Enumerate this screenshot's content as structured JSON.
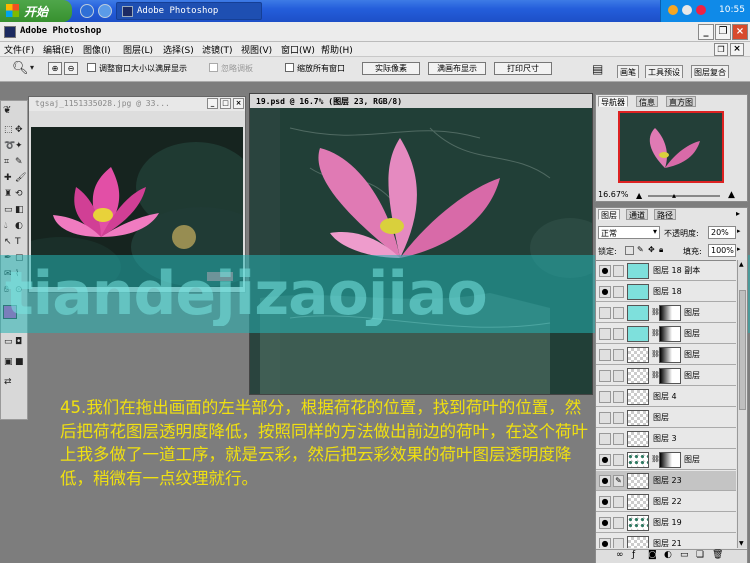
{
  "taskbar": {
    "start_label": "开始",
    "task_label": "Adobe Photoshop",
    "clock": "10:55"
  },
  "app": {
    "title": "Adobe Photoshop"
  },
  "menus": [
    "文件(F)",
    "编辑(E)",
    "图像(I)",
    "图层(L)",
    "选择(S)",
    "滤镜(T)",
    "视图(V)",
    "窗口(W)",
    "帮助(H)"
  ],
  "options": {
    "resize_window": "调整窗口大小以满屏显示",
    "ignore_palettes": "忽略调板",
    "zoom_all": "缩放所有窗口",
    "actual_pixels": "实际像素",
    "fit_screen": "满画布显示",
    "print_size": "打印尺寸",
    "palette_tabs": [
      "画笔",
      "工具预设",
      "图层复合"
    ]
  },
  "doc1": {
    "title": "tgsaj_1151335028.jpg @ 33..."
  },
  "doc2": {
    "title": "19.psd @ 16.7% (图层 23, RGB/8)"
  },
  "watermark": "tiandejizaojiao",
  "caption": "45.我们在拖出画面的左半部分，根据荷花的位置，找到荷叶的位置，然后把荷花图层透明度降低，按照同样的方法做出前边的荷叶，在这个荷叶上我多做了一道工序，就是云彩，然后把云彩效果的荷叶图层透明度降低，稍微有一点纹理就行。",
  "navigator": {
    "tabs": [
      "导航器",
      "信息",
      "直方图"
    ],
    "zoom": "16.67%"
  },
  "layers_panel": {
    "tabs": [
      "图层",
      "通道",
      "路径"
    ],
    "blend_mode": "正常",
    "opacity_label": "不透明度:",
    "opacity": "20%",
    "lock_label": "锁定:",
    "fill_label": "填充:",
    "fill": "100%",
    "layers": [
      {
        "name": "图层 18 副本",
        "visible": true,
        "mask": false,
        "thumb": "teal"
      },
      {
        "name": "图层 18",
        "visible": true,
        "mask": false,
        "thumb": "teal"
      },
      {
        "name": "图层",
        "visible": false,
        "mask": true,
        "thumb": "teal"
      },
      {
        "name": "图层",
        "visible": false,
        "mask": true,
        "thumb": "teal"
      },
      {
        "name": "图层",
        "visible": false,
        "mask": true,
        "thumb": "checker"
      },
      {
        "name": "图层",
        "visible": false,
        "mask": true,
        "thumb": "checker"
      },
      {
        "name": "图层 4",
        "visible": false,
        "mask": false,
        "thumb": "checker"
      },
      {
        "name": "图层",
        "visible": false,
        "mask": false,
        "thumb": "checker"
      },
      {
        "name": "图层 3",
        "visible": false,
        "mask": false,
        "thumb": "checker"
      },
      {
        "name": "图层",
        "visible": true,
        "mask": true,
        "thumb": "leaf"
      },
      {
        "name": "图层 23",
        "visible": true,
        "mask": false,
        "thumb": "checker",
        "selected": true
      },
      {
        "name": "图层 22",
        "visible": true,
        "mask": false,
        "thumb": "checker"
      },
      {
        "name": "图层 19",
        "visible": true,
        "mask": false,
        "thumb": "leaf"
      },
      {
        "name": "图层 21",
        "visible": true,
        "mask": false,
        "thumb": "checker"
      }
    ]
  }
}
